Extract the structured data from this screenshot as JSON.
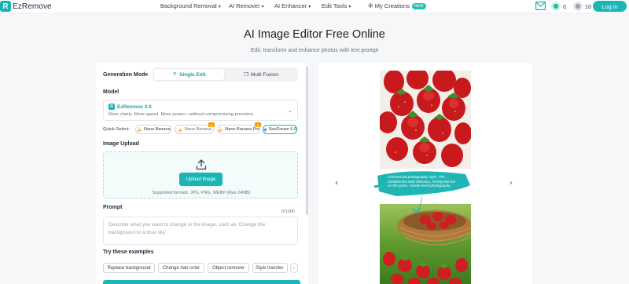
{
  "header": {
    "brand": "EzRemove",
    "nav": [
      {
        "label": "Background Removal"
      },
      {
        "label": "AI Remover"
      },
      {
        "label": "AI Enhancer"
      },
      {
        "label": "Edit Tools"
      },
      {
        "label": "My Creations",
        "badge": "NEW"
      }
    ],
    "credits": [
      {
        "value": "0"
      },
      {
        "value": "10"
      }
    ],
    "login": "Log in"
  },
  "hero": {
    "title": "AI Image Editor Free Online",
    "subtitle": "Edit, transform and enhance photos with text prompt"
  },
  "editor": {
    "generation_mode_label": "Generation Mode",
    "modes": [
      {
        "label": "Single Edit"
      },
      {
        "label": "Multi Fusion"
      }
    ],
    "model_label": "Model",
    "model": {
      "name": "EzRemove 4.0",
      "description": "More clarity. More speed. More power—without compromising precision."
    },
    "quick_select_label": "Quick Select:",
    "quick_select": [
      {
        "label": "Nano Banana"
      },
      {
        "label": "Nano Banana"
      },
      {
        "label": "Nano Banana Pro"
      },
      {
        "label": "SeeDream 5.0"
      }
    ],
    "upload_label": "Image Upload",
    "upload_button": "Upload Image",
    "upload_hint": "Supported formats: JPG, PNG, WEBP (Max 24MB)",
    "prompt_label": "Prompt",
    "prompt_count": "0/1000",
    "prompt_placeholder": "Describe what you want to change in the image, such as 'Change the background to a blue sky'.",
    "examples_label": "Try these examples",
    "examples": [
      {
        "label": "Replace background"
      },
      {
        "label": "Change hair color"
      },
      {
        "label": "Object remover"
      },
      {
        "label": "Style transfer"
      }
    ]
  },
  "preview": {
    "caption": "Commercial photography style. The strawberries look delicious, freshly laid out on the grass, master-level photography."
  },
  "colors": {
    "accent": "#1db4b6",
    "page_bg": "#f6f7f9"
  }
}
